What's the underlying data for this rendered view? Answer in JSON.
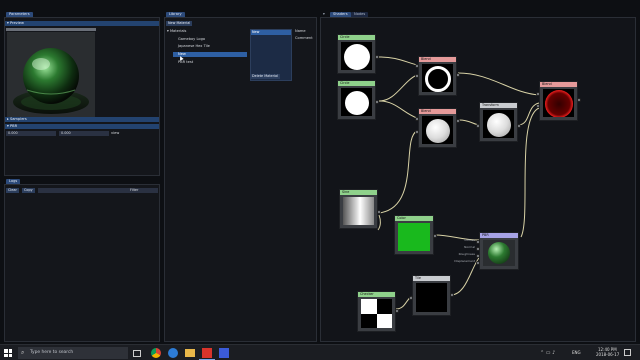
{
  "parameters": {
    "tab": "Parameters",
    "preview_header": "Preview",
    "samplers_header": "Samplers",
    "pbr_header": "PBR",
    "value_a": "0.000",
    "value_b": "0.000",
    "view_label": "view"
  },
  "library": {
    "tab": "Library",
    "new_material": "New Material",
    "tree_root": "Materials",
    "items": [
      {
        "label": "Gameboy Logo"
      },
      {
        "label": "Japanese Hex Tile"
      },
      {
        "label": "New"
      },
      {
        "label": "PBR test"
      }
    ],
    "list_header": "New",
    "name_label": "Name",
    "comment_label": "Comment",
    "delete_material": "Delete Material"
  },
  "logs": {
    "tab": "Logs",
    "clear": "Clear",
    "copy": "Copy",
    "filter": "Filter"
  },
  "shaders": {
    "tab": "Shaders",
    "nodes_tab": "Nodes",
    "nodes": {
      "circle1": "Circle",
      "circle2": "Circle",
      "blend1": "Blend",
      "blend2": "Blend",
      "transform": "Transform",
      "blend_out": "Blend",
      "sine": "Sine",
      "color": "Color",
      "pbr": "PBR",
      "tile": "Tile",
      "checker": "Checker"
    },
    "pbr_pins": [
      "Diffuse",
      "Normal",
      "Roughness",
      "Displacement"
    ]
  },
  "taskbar": {
    "search_placeholder": "Type here to search",
    "time": "12:40 PM",
    "date": "2018-06-17",
    "lang": "ENG"
  },
  "colors": {
    "accent": "#2c4a7a",
    "node_green": "#8fd18b",
    "node_red": "#e59a9a",
    "node_gray": "#c9ccd0",
    "node_purple": "#a7a3e6"
  }
}
